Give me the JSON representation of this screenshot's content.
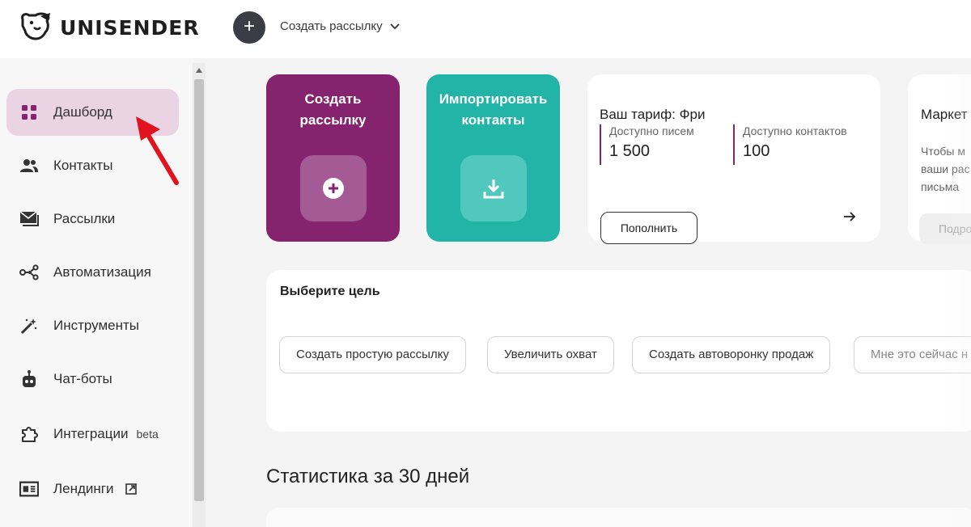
{
  "brand": {
    "name": "UNISENDER"
  },
  "header": {
    "create_menu_label": "Создать рассылку"
  },
  "sidebar": {
    "items": [
      {
        "label": "Дашборд",
        "icon": "dashboard-grid-icon",
        "active": true
      },
      {
        "label": "Контакты",
        "icon": "people-icon"
      },
      {
        "label": "Рассылки",
        "icon": "mail-stack-icon"
      },
      {
        "label": "Автоматизация",
        "icon": "nodes-icon"
      },
      {
        "label": "Инструменты",
        "icon": "magic-wand-icon"
      },
      {
        "label": "Чат-боты",
        "icon": "robot-icon"
      },
      {
        "label": "Интеграции",
        "icon": "puzzle-icon",
        "badge": "beta"
      },
      {
        "label": "Лендинги",
        "icon": "landing-page-icon",
        "external": true
      }
    ]
  },
  "tiles": {
    "create_campaign": {
      "line1": "Создать",
      "line2": "рассылку"
    },
    "import_contacts": {
      "line1": "Импортировать",
      "line2": "контакты"
    }
  },
  "tariff": {
    "title": "Ваш тариф: Фри",
    "emails_label": "Доступно писем",
    "emails_value": "1 500",
    "contacts_label": "Доступно контактов",
    "contacts_value": "100",
    "topup_label": "Пополнить"
  },
  "market": {
    "title": "Маркет",
    "text_line1": "Чтобы м",
    "text_line2": "ваши рас",
    "text_line3": "письма",
    "button_label": "Подро"
  },
  "goal": {
    "title": "Выберите цель",
    "options": [
      "Создать простую рассылку",
      "Увеличить охват",
      "Создать автоворонку продаж",
      "Мне это сейчас н"
    ]
  },
  "stats": {
    "title": "Статистика за 30 дней"
  },
  "colors": {
    "brand_purple": "#86236f",
    "teal": "#22b5a7",
    "active_nav_bg": "#ead4e4",
    "annotation_red": "#e0131e"
  }
}
